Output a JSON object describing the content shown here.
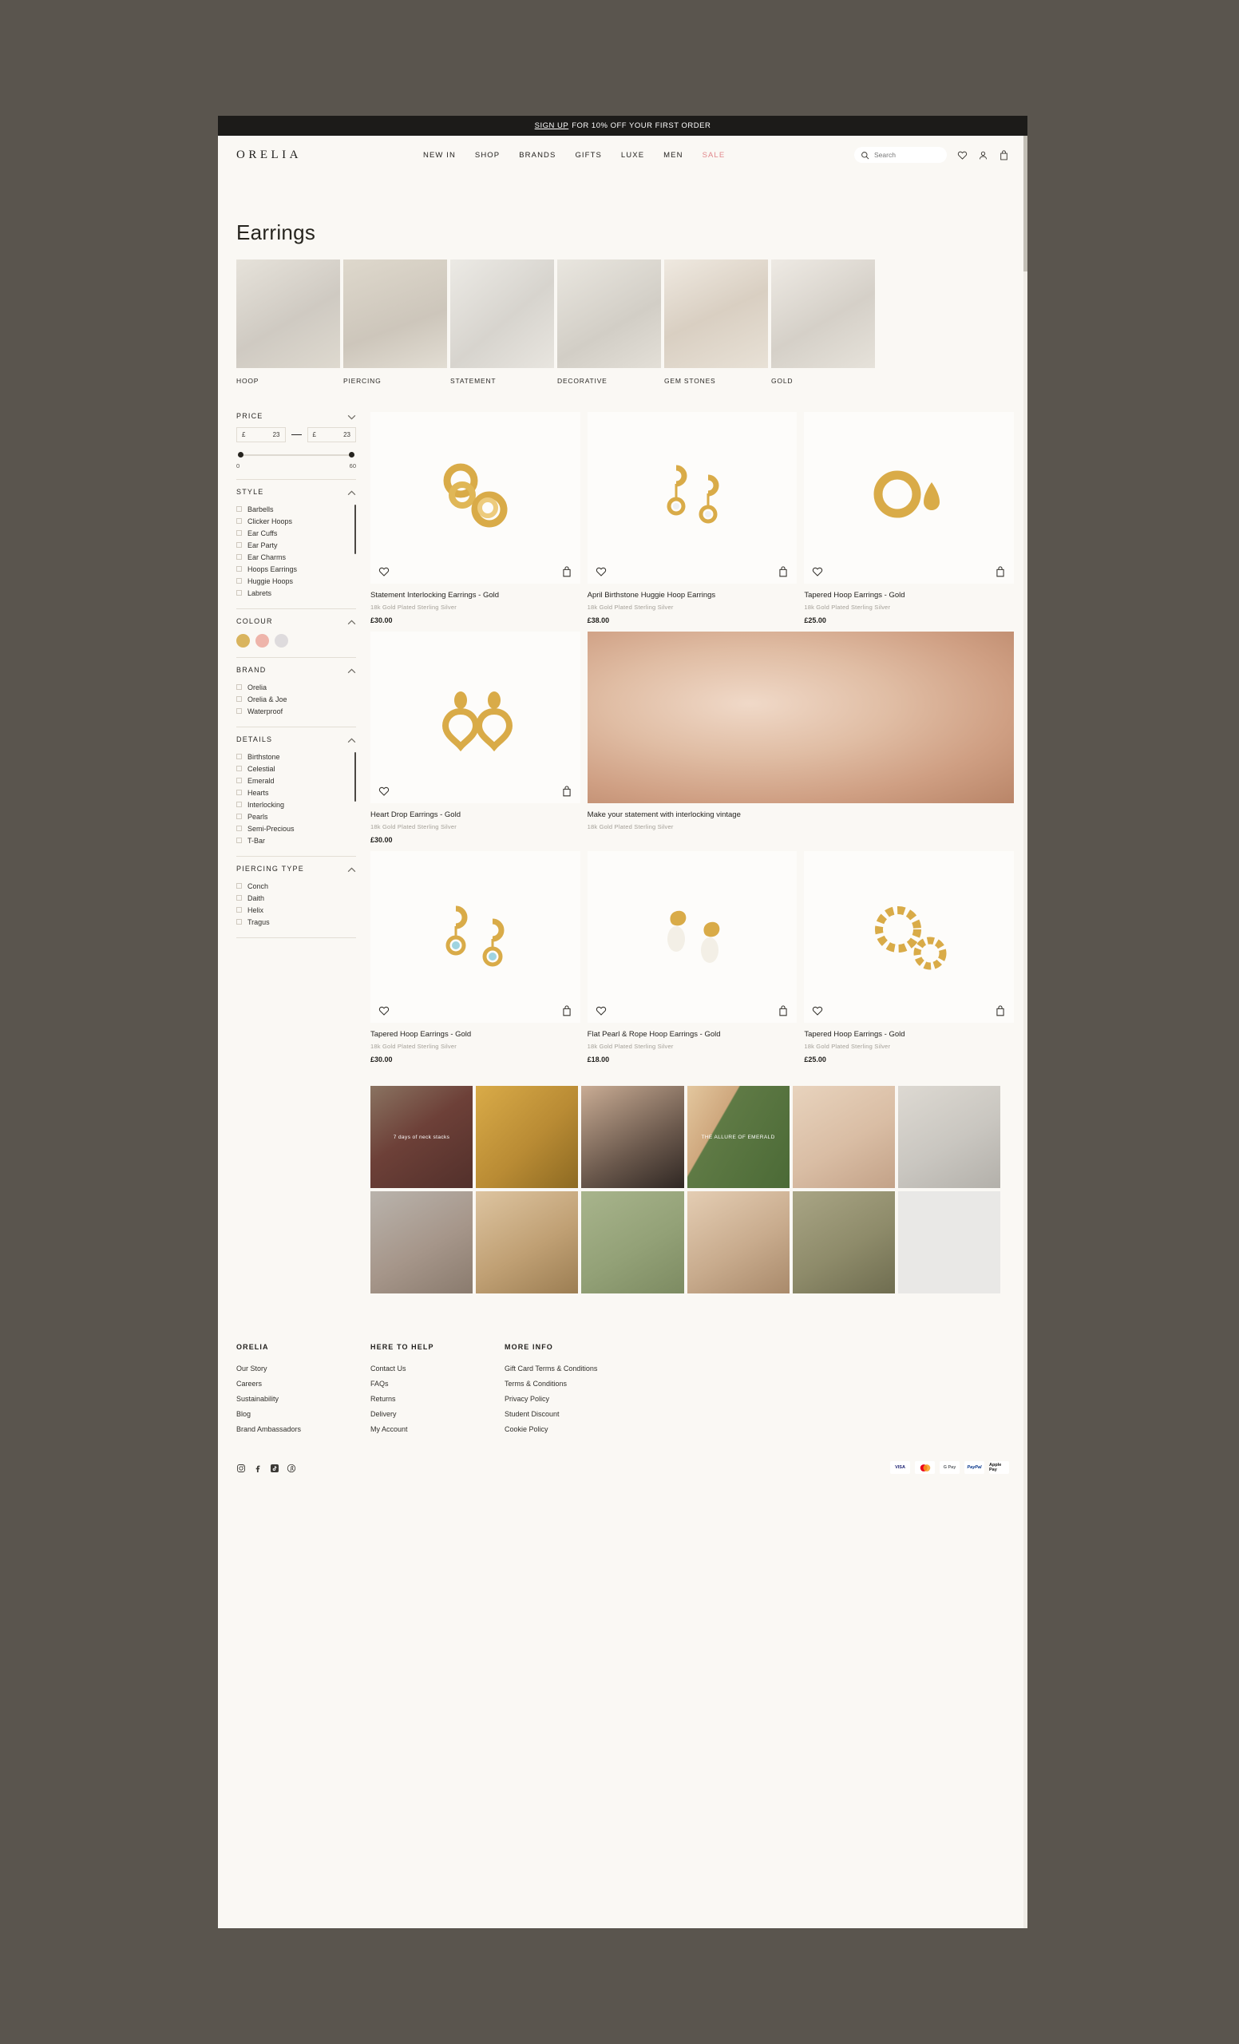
{
  "announcement": {
    "link_text": "SIGN UP",
    "text": "FOR 10% OFF YOUR FIRST ORDER"
  },
  "header": {
    "logo": "ORELIA",
    "nav": [
      {
        "label": "NEW IN"
      },
      {
        "label": "SHOP"
      },
      {
        "label": "BRANDS"
      },
      {
        "label": "GIFTS"
      },
      {
        "label": "LUXE"
      },
      {
        "label": "MEN"
      },
      {
        "label": "SALE"
      }
    ],
    "search_placeholder": "Search",
    "icons": [
      "search-icon",
      "wishlist-heart-icon",
      "account-icon",
      "bag-icon"
    ]
  },
  "page": {
    "title": "Earrings"
  },
  "categories": [
    {
      "label": "HOOP"
    },
    {
      "label": "PIERCING"
    },
    {
      "label": "STATEMENT"
    },
    {
      "label": "DECORATIVE"
    },
    {
      "label": "GEM STONES"
    },
    {
      "label": "GOLD"
    }
  ],
  "filters": {
    "price": {
      "title": "PRICE",
      "currency": "£",
      "min_value": "23",
      "max_value": "23",
      "range_min": "0",
      "range_max": "60"
    },
    "style": {
      "title": "STYLE",
      "options": [
        "Barbells",
        "Clicker Hoops",
        "Ear Cuffs",
        "Ear Party",
        "Ear Charms",
        "Hoops Earrings",
        "Huggie Hoops",
        "Labrets"
      ]
    },
    "colour": {
      "title": "COLOUR",
      "swatches": [
        {
          "name": "gold",
          "hex": "#d9b45e"
        },
        {
          "name": "rose",
          "hex": "#eeb4aa"
        },
        {
          "name": "silver",
          "hex": "#dedbdd"
        }
      ]
    },
    "brand": {
      "title": "BRAND",
      "options": [
        "Orelia",
        "Orelia & Joe",
        "Waterproof"
      ]
    },
    "details": {
      "title": "DETAILS",
      "options": [
        "Birthstone",
        "Celestial",
        "Emerald",
        "Hearts",
        "Interlocking",
        "Pearls",
        "Semi-Precious",
        "T-Bar"
      ]
    },
    "piercing_type": {
      "title": "PIERCING TYPE",
      "options": [
        "Conch",
        "Daith",
        "Helix",
        "Tragus"
      ]
    }
  },
  "products": [
    {
      "title": "Statement Interlocking Earrings - Gold",
      "subtitle": "18k Gold Plated Sterling Silver",
      "price": "£30.00",
      "type": "product"
    },
    {
      "title": "April Birthstone Huggie Hoop Earrings",
      "subtitle": "18k Gold Plated Sterling Silver",
      "price": "£38.00",
      "type": "product"
    },
    {
      "title": "Tapered Hoop Earrings - Gold",
      "subtitle": "18k Gold Plated Sterling Silver",
      "price": "£25.00",
      "type": "product"
    },
    {
      "title": "Heart Drop Earrings - Gold",
      "subtitle": "18k Gold Plated Sterling Silver",
      "price": "£30.00",
      "type": "product"
    },
    {
      "title": "Make your statement with interlocking vintage",
      "subtitle": "18k Gold Plated Sterling Silver",
      "price": "",
      "type": "banner"
    },
    {
      "title": "Tapered Hoop Earrings - Gold",
      "subtitle": "18k Gold Plated Sterling Silver",
      "price": "£30.00",
      "type": "product"
    },
    {
      "title": "Flat Pearl & Rope Hoop Earrings - Gold",
      "subtitle": "18k Gold Plated Sterling Silver",
      "price": "£18.00",
      "type": "product"
    },
    {
      "title": "Tapered Hoop Earrings - Gold",
      "subtitle": "18k Gold Plated Sterling Silver",
      "price": "£25.00",
      "type": "product"
    }
  ],
  "gallery": [
    {
      "caption": "7 days of neck stacks",
      "bg": "#6d4038"
    },
    {
      "caption": "",
      "bg": "#b98b34"
    },
    {
      "caption": "",
      "bg": "#6a584c"
    },
    {
      "caption": "THE ALLURE OF EMERALD",
      "bg": "#5f7a45"
    },
    {
      "caption": "",
      "bg": "#d9bda4"
    },
    {
      "caption": "",
      "bg": "#c9c6c0"
    },
    {
      "caption": "",
      "bg": "#a6968a"
    },
    {
      "caption": "",
      "bg": "#c0a074"
    },
    {
      "caption": "",
      "bg": "#93a177"
    },
    {
      "caption": "",
      "bg": "#c8ab8d"
    },
    {
      "caption": "",
      "bg": "#8e8b6a"
    },
    {
      "caption": "",
      "bg": "#e9e8e6"
    }
  ],
  "footer": {
    "columns": [
      {
        "heading": "ORELIA",
        "links": [
          "Our Story",
          "Careers",
          "Sustainability",
          "Blog",
          "Brand Ambassadors"
        ]
      },
      {
        "heading": "HERE TO HELP",
        "links": [
          "Contact Us",
          "FAQs",
          "Returns",
          "Delivery",
          "My Account"
        ]
      },
      {
        "heading": "MORE INFO",
        "links": [
          "Gift Card Terms & Conditions",
          "Terms & Conditions",
          "Privacy Policy",
          "Student Discount",
          "Cookie Policy"
        ]
      }
    ],
    "socials": [
      "instagram-icon",
      "facebook-icon",
      "tiktok-icon",
      "pinterest-icon"
    ],
    "payments": [
      "VISA",
      "Mastercard",
      "G Pay",
      "PayPal",
      "Apple Pay"
    ]
  }
}
